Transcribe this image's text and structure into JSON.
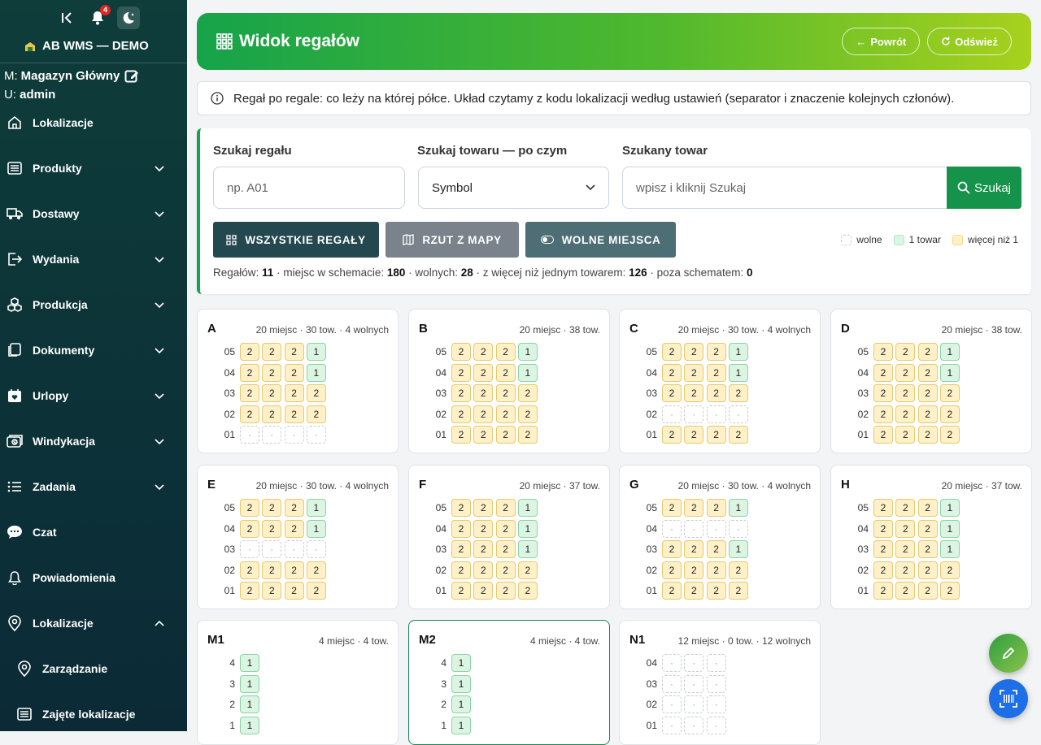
{
  "sidebar": {
    "notif_count": "4",
    "brand": "AB WMS — DEMO",
    "warehouse_prefix": "M:",
    "warehouse": "Magazyn Główny",
    "user_prefix": "U:",
    "user": "admin",
    "items": [
      {
        "label": "Lokalizacje",
        "icon": "home-icon",
        "chevron": false
      },
      {
        "label": "Produkty",
        "icon": "list-icon",
        "chevron": true
      },
      {
        "label": "Dostawy",
        "icon": "truck-icon",
        "chevron": true
      },
      {
        "label": "Wydania",
        "icon": "exit-icon",
        "chevron": true
      },
      {
        "label": "Produkcja",
        "icon": "boxes-icon",
        "chevron": true
      },
      {
        "label": "Dokumenty",
        "icon": "documents-icon",
        "chevron": true
      },
      {
        "label": "Urlopy",
        "icon": "calendar-heart-icon",
        "chevron": true
      },
      {
        "label": "Windykacja",
        "icon": "cash-icon",
        "chevron": true
      },
      {
        "label": "Zadania",
        "icon": "tasks-icon",
        "chevron": true
      },
      {
        "label": "Czat",
        "icon": "chat-icon",
        "chevron": false
      },
      {
        "label": "Powiadomienia",
        "icon": "bell-icon",
        "chevron": false
      },
      {
        "label": "Lokalizacje",
        "icon": "location-icon",
        "chevron": "up"
      }
    ],
    "sub_items": [
      {
        "label": "Zarządzanie",
        "icon": "location-icon"
      },
      {
        "label": "Zajęte lokalizacje",
        "icon": "list-icon"
      }
    ]
  },
  "header": {
    "title": "Widok regałów",
    "back_label": "Powrót",
    "refresh_label": "Odśwież"
  },
  "info": "Regał po regale: co leży na której półce. Układ czytamy z kodu lokalizacji według ustawień (separator i znaczenie kolejnych członów).",
  "filters": {
    "rack_label": "Szukaj regału",
    "rack_placeholder": "np. A01",
    "by_label": "Szukaj towaru — po czym",
    "by_value": "Symbol",
    "item_label": "Szukany towar",
    "item_placeholder": "wpisz i kliknij Szukaj",
    "search_btn": "Szukaj",
    "all_racks_btn": "WSZYSTKIE REGAŁY",
    "map_btn": "RZUT Z MAPY",
    "free_btn": "WOLNE MIEJSCA",
    "legend": [
      {
        "label": "wolne",
        "type": "free"
      },
      {
        "label": "1 towar",
        "type": "one"
      },
      {
        "label": "więcej niż 1",
        "type": "many"
      }
    ],
    "stats": {
      "racks_label": "Regałów:",
      "racks": "11",
      "places_label": "· miejsc w schemacie:",
      "places": "180",
      "free_label": "· wolnych:",
      "free": "28",
      "multi_label": "· z więcej niż jednym towarem:",
      "multi": "126",
      "outside_label": "· poza schematem:",
      "outside": "0"
    }
  },
  "colors": {
    "free": "#ffffff",
    "one": "#dcf5e3",
    "many": "#fff1c7",
    "accent": "#16a34a"
  },
  "racks": [
    {
      "name": "A",
      "meta": "20 miejsc · 30 tow. · 4 wolnych",
      "rows": [
        {
          "label": "05",
          "cells": [
            "2",
            "2",
            "2",
            "1"
          ]
        },
        {
          "label": "04",
          "cells": [
            "2",
            "2",
            "2",
            "1"
          ]
        },
        {
          "label": "03",
          "cells": [
            "2",
            "2",
            "2",
            "2"
          ]
        },
        {
          "label": "02",
          "cells": [
            "2",
            "2",
            "2",
            "2"
          ]
        },
        {
          "label": "01",
          "cells": [
            "·",
            "·",
            "·",
            "·"
          ]
        }
      ]
    },
    {
      "name": "B",
      "meta": "20 miejsc · 38 tow.",
      "rows": [
        {
          "label": "05",
          "cells": [
            "2",
            "2",
            "2",
            "1"
          ]
        },
        {
          "label": "04",
          "cells": [
            "2",
            "2",
            "2",
            "1"
          ]
        },
        {
          "label": "03",
          "cells": [
            "2",
            "2",
            "2",
            "2"
          ]
        },
        {
          "label": "02",
          "cells": [
            "2",
            "2",
            "2",
            "2"
          ]
        },
        {
          "label": "01",
          "cells": [
            "2",
            "2",
            "2",
            "2"
          ]
        }
      ]
    },
    {
      "name": "C",
      "meta": "20 miejsc · 30 tow. · 4 wolnych",
      "rows": [
        {
          "label": "05",
          "cells": [
            "2",
            "2",
            "2",
            "1"
          ]
        },
        {
          "label": "04",
          "cells": [
            "2",
            "2",
            "2",
            "1"
          ]
        },
        {
          "label": "03",
          "cells": [
            "2",
            "2",
            "2",
            "2"
          ]
        },
        {
          "label": "02",
          "cells": [
            "·",
            "·",
            "·",
            "·"
          ]
        },
        {
          "label": "01",
          "cells": [
            "2",
            "2",
            "2",
            "2"
          ]
        }
      ]
    },
    {
      "name": "D",
      "meta": "20 miejsc · 38 tow.",
      "rows": [
        {
          "label": "05",
          "cells": [
            "2",
            "2",
            "2",
            "1"
          ]
        },
        {
          "label": "04",
          "cells": [
            "2",
            "2",
            "2",
            "1"
          ]
        },
        {
          "label": "03",
          "cells": [
            "2",
            "2",
            "2",
            "2"
          ]
        },
        {
          "label": "02",
          "cells": [
            "2",
            "2",
            "2",
            "2"
          ]
        },
        {
          "label": "01",
          "cells": [
            "2",
            "2",
            "2",
            "2"
          ]
        }
      ]
    },
    {
      "name": "E",
      "meta": "20 miejsc · 30 tow. · 4 wolnych",
      "rows": [
        {
          "label": "05",
          "cells": [
            "2",
            "2",
            "2",
            "1"
          ]
        },
        {
          "label": "04",
          "cells": [
            "2",
            "2",
            "2",
            "1"
          ]
        },
        {
          "label": "03",
          "cells": [
            "·",
            "·",
            "·",
            "·"
          ]
        },
        {
          "label": "02",
          "cells": [
            "2",
            "2",
            "2",
            "2"
          ]
        },
        {
          "label": "01",
          "cells": [
            "2",
            "2",
            "2",
            "2"
          ]
        }
      ]
    },
    {
      "name": "F",
      "meta": "20 miejsc · 37 tow.",
      "rows": [
        {
          "label": "05",
          "cells": [
            "2",
            "2",
            "2",
            "1"
          ]
        },
        {
          "label": "04",
          "cells": [
            "2",
            "2",
            "2",
            "1"
          ]
        },
        {
          "label": "03",
          "cells": [
            "2",
            "2",
            "2",
            "1"
          ]
        },
        {
          "label": "02",
          "cells": [
            "2",
            "2",
            "2",
            "2"
          ]
        },
        {
          "label": "01",
          "cells": [
            "2",
            "2",
            "2",
            "2"
          ]
        }
      ]
    },
    {
      "name": "G",
      "meta": "20 miejsc · 30 tow. · 4 wolnych",
      "rows": [
        {
          "label": "05",
          "cells": [
            "2",
            "2",
            "2",
            "1"
          ]
        },
        {
          "label": "04",
          "cells": [
            "·",
            "·",
            "·",
            "·"
          ]
        },
        {
          "label": "03",
          "cells": [
            "2",
            "2",
            "2",
            "1"
          ]
        },
        {
          "label": "02",
          "cells": [
            "2",
            "2",
            "2",
            "2"
          ]
        },
        {
          "label": "01",
          "cells": [
            "2",
            "2",
            "2",
            "2"
          ]
        }
      ]
    },
    {
      "name": "H",
      "meta": "20 miejsc · 37 tow.",
      "rows": [
        {
          "label": "05",
          "cells": [
            "2",
            "2",
            "2",
            "1"
          ]
        },
        {
          "label": "04",
          "cells": [
            "2",
            "2",
            "2",
            "1"
          ]
        },
        {
          "label": "03",
          "cells": [
            "2",
            "2",
            "2",
            "1"
          ]
        },
        {
          "label": "02",
          "cells": [
            "2",
            "2",
            "2",
            "2"
          ]
        },
        {
          "label": "01",
          "cells": [
            "2",
            "2",
            "2",
            "2"
          ]
        }
      ]
    },
    {
      "name": "M1",
      "meta": "4 miejsc · 4 tow.",
      "rows": [
        {
          "label": "4",
          "cells": [
            "1"
          ]
        },
        {
          "label": "3",
          "cells": [
            "1"
          ]
        },
        {
          "label": "2",
          "cells": [
            "1"
          ]
        },
        {
          "label": "1",
          "cells": [
            "1"
          ]
        }
      ]
    },
    {
      "name": "M2",
      "meta": "4 miejsc · 4 tow.",
      "selected": true,
      "rows": [
        {
          "label": "4",
          "cells": [
            "1"
          ]
        },
        {
          "label": "3",
          "cells": [
            "1"
          ]
        },
        {
          "label": "2",
          "cells": [
            "1"
          ]
        },
        {
          "label": "1",
          "cells": [
            "1"
          ]
        }
      ]
    },
    {
      "name": "N1",
      "meta": "12 miejsc · 0 tow. · 12 wolnych",
      "rows": [
        {
          "label": "04",
          "cells": [
            "·",
            "·",
            "·"
          ]
        },
        {
          "label": "03",
          "cells": [
            "·",
            "·",
            "·"
          ]
        },
        {
          "label": "02",
          "cells": [
            "·",
            "·",
            "·"
          ]
        },
        {
          "label": "01",
          "cells": [
            "·",
            "·",
            "·"
          ]
        }
      ]
    }
  ]
}
